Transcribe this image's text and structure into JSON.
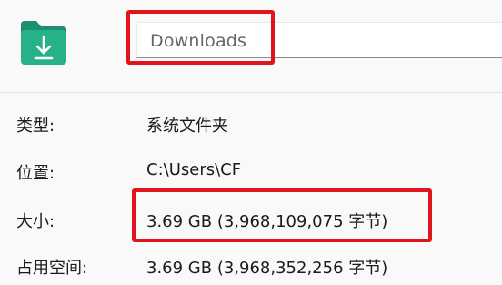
{
  "header": {
    "icon": "downloads-folder-icon",
    "name_value": "Downloads"
  },
  "properties": {
    "type": {
      "label": "类型:",
      "value": "系统文件夹"
    },
    "location": {
      "label": "位置:",
      "value": "C:\\Users\\CF"
    },
    "size": {
      "label": "大小:",
      "value": "3.69 GB (3,968,109,075 字节)"
    },
    "size_on_disk": {
      "label": "占用空间:",
      "value": "3.69 GB (3,968,352,256 字节)"
    }
  },
  "colors": {
    "highlight": "#e0141c",
    "folder_green": "#1fa37f",
    "folder_green_light": "#2ab88e"
  }
}
